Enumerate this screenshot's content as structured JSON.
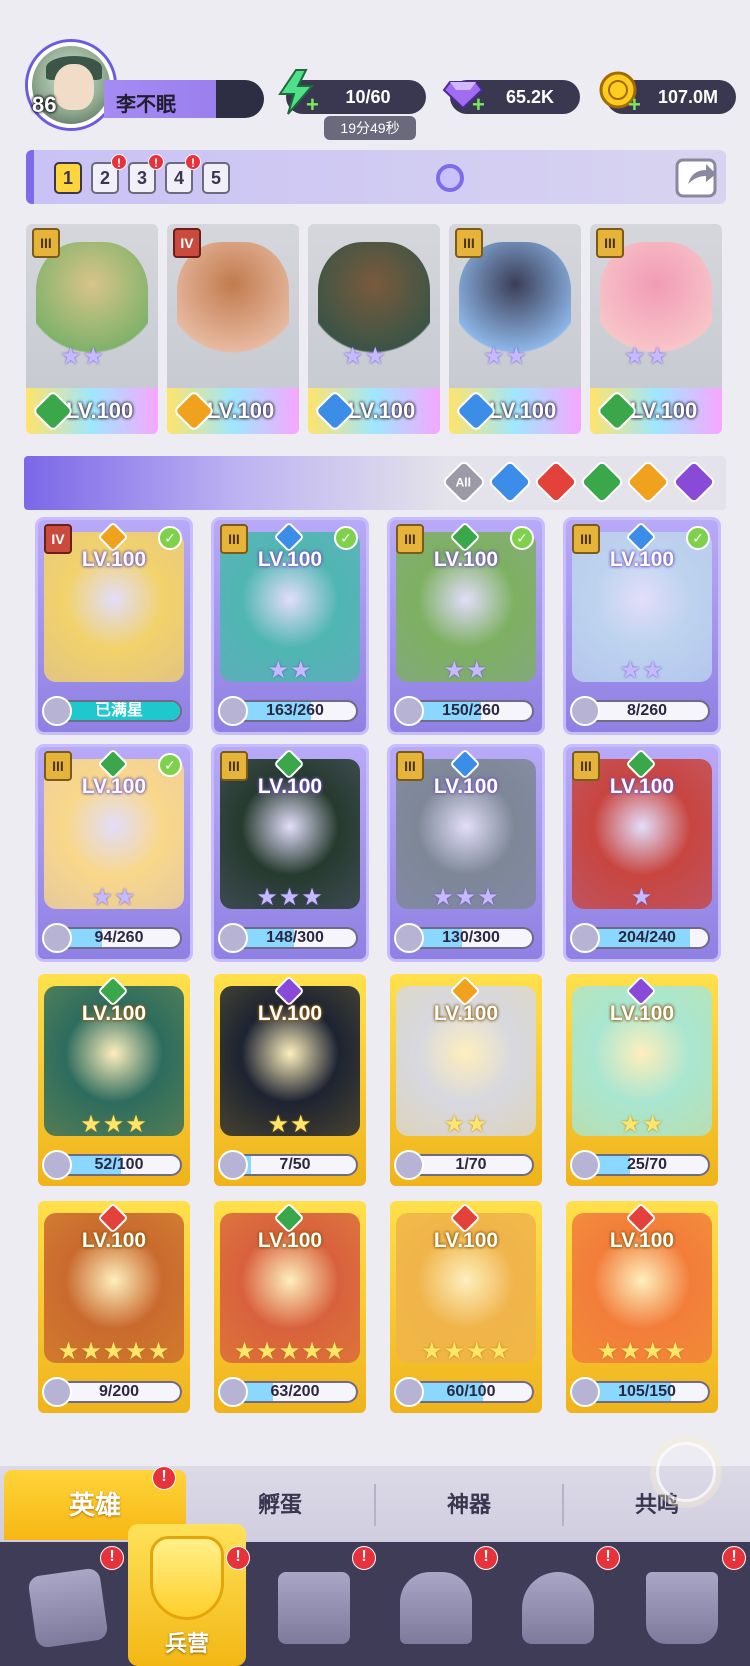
{
  "player": {
    "level": "86",
    "name": "李不眠"
  },
  "resources": {
    "energy": "10/60",
    "energy_timer": "19分49秒",
    "gems": "65.2K",
    "gold": "107.0M"
  },
  "team_slots": [
    {
      "label": "1",
      "active": true,
      "alert": false
    },
    {
      "label": "2",
      "active": false,
      "alert": true
    },
    {
      "label": "3",
      "active": false,
      "alert": true
    },
    {
      "label": "4",
      "active": false,
      "alert": true
    },
    {
      "label": "5",
      "active": false,
      "alert": false
    }
  ],
  "team": [
    {
      "rank": "III",
      "element": "wind",
      "stars": "★★",
      "level": "LV.100"
    },
    {
      "rank": "IV",
      "element": "light",
      "stars": "",
      "level": "LV.100"
    },
    {
      "rank": "",
      "element": "water",
      "stars": "★★",
      "level": "LV.100"
    },
    {
      "rank": "III",
      "element": "water",
      "stars": "★★",
      "level": "LV.100"
    },
    {
      "rank": "III",
      "element": "wind",
      "stars": "★★",
      "level": "LV.100"
    }
  ],
  "filters": [
    {
      "name": "all",
      "label": "All"
    },
    {
      "name": "water",
      "label": ""
    },
    {
      "name": "fire",
      "label": ""
    },
    {
      "name": "wind",
      "label": ""
    },
    {
      "name": "light",
      "label": ""
    },
    {
      "name": "dark",
      "label": ""
    }
  ],
  "heroes": [
    {
      "rank": "IV",
      "element": "light",
      "level": "LV.100",
      "stars": "",
      "progress": "已满星",
      "fill": 1.0,
      "full": true,
      "check": true,
      "tier": "purple"
    },
    {
      "rank": "III",
      "element": "water",
      "level": "LV.100",
      "stars": "★★",
      "progress": "163/260",
      "fill": 0.63,
      "full": false,
      "check": true,
      "tier": "purple"
    },
    {
      "rank": "III",
      "element": "wind",
      "level": "LV.100",
      "stars": "★★",
      "progress": "150/260",
      "fill": 0.58,
      "full": false,
      "check": true,
      "tier": "purple"
    },
    {
      "rank": "III",
      "element": "water",
      "level": "LV.100",
      "stars": "★★",
      "progress": "8/260",
      "fill": 0.03,
      "full": false,
      "check": true,
      "tier": "purple"
    },
    {
      "rank": "III",
      "element": "wind",
      "level": "LV.100",
      "stars": "★★",
      "progress": "94/260",
      "fill": 0.36,
      "full": false,
      "check": true,
      "tier": "purple"
    },
    {
      "rank": "III",
      "element": "wind",
      "level": "LV.100",
      "stars": "★★★",
      "progress": "148/300",
      "fill": 0.49,
      "full": false,
      "check": false,
      "tier": "purple"
    },
    {
      "rank": "III",
      "element": "water",
      "level": "LV.100",
      "stars": "★★★",
      "progress": "130/300",
      "fill": 0.43,
      "full": false,
      "check": false,
      "tier": "purple"
    },
    {
      "rank": "III",
      "element": "wind",
      "level": "LV.100",
      "stars": "★",
      "progress": "204/240",
      "fill": 0.85,
      "full": false,
      "check": false,
      "tier": "purple"
    },
    {
      "rank": "",
      "element": "wind",
      "level": "LV.100",
      "stars": "★★★",
      "progress": "52/100",
      "fill": 0.52,
      "full": false,
      "check": false,
      "tier": "gold"
    },
    {
      "rank": "",
      "element": "dark",
      "level": "LV.100",
      "stars": "★★",
      "progress": "7/50",
      "fill": 0.14,
      "full": false,
      "check": false,
      "tier": "gold"
    },
    {
      "rank": "",
      "element": "light",
      "level": "LV.100",
      "stars": "★★",
      "progress": "1/70",
      "fill": 0.01,
      "full": false,
      "check": false,
      "tier": "gold"
    },
    {
      "rank": "",
      "element": "dark",
      "level": "LV.100",
      "stars": "★★",
      "progress": "25/70",
      "fill": 0.36,
      "full": false,
      "check": false,
      "tier": "gold"
    },
    {
      "rank": "",
      "element": "fire",
      "level": "LV.100",
      "stars": "★★★★★",
      "progress": "9/200",
      "fill": 0.05,
      "full": false,
      "check": false,
      "tier": "gold"
    },
    {
      "rank": "",
      "element": "wind",
      "level": "LV.100",
      "stars": "★★★★★",
      "progress": "63/200",
      "fill": 0.32,
      "full": false,
      "check": false,
      "tier": "gold"
    },
    {
      "rank": "",
      "element": "fire",
      "level": "LV.100",
      "stars": "★★★★",
      "progress": "60/100",
      "fill": 0.6,
      "full": false,
      "check": false,
      "tier": "gold"
    },
    {
      "rank": "",
      "element": "fire",
      "level": "LV.100",
      "stars": "★★★★",
      "progress": "105/150",
      "fill": 0.7,
      "full": false,
      "check": false,
      "tier": "gold"
    }
  ],
  "subtabs": [
    "英雄",
    "孵蛋",
    "神器",
    "共鸣"
  ],
  "bottom_nav": {
    "active_label": "兵营"
  },
  "colors": {
    "water": "#3c8de8",
    "fire": "#e2423a",
    "wind": "#3aa74a",
    "light": "#f0a21e",
    "dark": "#8a4ad8",
    "all": "#9c9aa6"
  },
  "icons": {
    "energy": "lightning-icon",
    "gems": "gem-icon",
    "gold": "coin-icon",
    "share": "share-icon",
    "zoom": "magnifier-icon"
  }
}
